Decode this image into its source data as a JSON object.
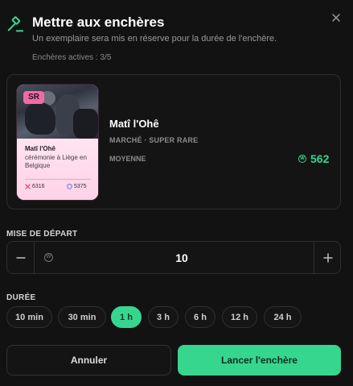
{
  "header": {
    "icon": "gavel-icon",
    "title": "Mettre aux enchères",
    "subtitle": "Un exemplaire sera mis en réserve pour la durée de l'enchère.",
    "active_auctions": "Enchères actives : 3/5",
    "close_icon": "close-icon"
  },
  "card": {
    "rarity_badge": "SR",
    "mini_name": "Matî l'Ohê",
    "mini_description": "cérémonie à Liège en Belgique",
    "stat_attack": "6316",
    "stat_defense": "5375",
    "name": "Matî l'Ohê",
    "market": "MARCHÉ · SUPER RARE",
    "tier": "MOYENNE",
    "price": "562",
    "price_color": "#36d68f",
    "rarity_color": "#f06aa8"
  },
  "starting_bid": {
    "label": "MISE DE DÉPART",
    "value": "10",
    "minus_icon": "minus-icon",
    "plus_icon": "plus-icon"
  },
  "duration": {
    "label": "DURÉE",
    "options": [
      "10 min",
      "30 min",
      "1 h",
      "3 h",
      "6 h",
      "12 h",
      "24 h"
    ],
    "selected": "1 h"
  },
  "actions": {
    "cancel_label": "Annuler",
    "confirm_label": "Lancer l'enchère"
  }
}
